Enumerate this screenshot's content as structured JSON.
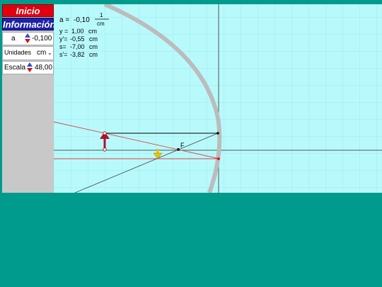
{
  "sidebar": {
    "inicio_label": "Inicio",
    "informacion_label": "Información",
    "controls": {
      "a": {
        "label": "a",
        "value": "-0,100"
      },
      "unidades": {
        "label": "Unidades",
        "value": "cm"
      },
      "escala": {
        "label": "Escala",
        "value": "48,00"
      }
    }
  },
  "readout": {
    "a_label": "a =",
    "a_value": "-0,10",
    "frac_num": "1",
    "frac_den": "cm",
    "rows": [
      {
        "name": "y =",
        "value": "1,00",
        "unit": "cm"
      },
      {
        "name": "y'=",
        "value": "-0,55",
        "unit": "cm"
      },
      {
        "name": "s=",
        "value": "-7,00",
        "unit": "cm"
      },
      {
        "name": "s'=",
        "value": "-3,82",
        "unit": "cm"
      }
    ]
  },
  "diagram": {
    "focus_label": "F"
  },
  "colors": {
    "background": "#009b8c",
    "canvas": "#b8fafc",
    "grid": "#9ce0e6",
    "object_arrow": "#b01030",
    "image_arrow": "#f0c000",
    "ray_red": "#e04040"
  }
}
